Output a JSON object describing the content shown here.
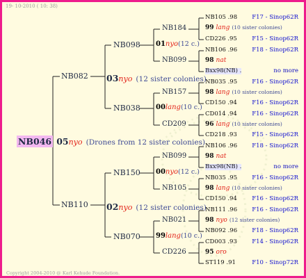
{
  "header": {
    "date": "19- 10-2010 ( 10: 38)"
  },
  "footer": {
    "copyright": "Copyright 2004-2010 @ Karl Kehude Foundation."
  },
  "focal": {
    "id": "NB046",
    "year": "05",
    "race": "nyo",
    "desc": "(Drones from 12 sister colonies)"
  },
  "gen1": [
    {
      "id": "NB082",
      "year": "03",
      "race": "nyo",
      "desc": "(12 sister colonies)"
    },
    {
      "id": "NB110",
      "year": "02",
      "race": "nyo",
      "desc": "(12 sister colonies)"
    }
  ],
  "gen2": [
    {
      "id": "NB098",
      "year": "01",
      "race": "nyo",
      "desc": "(12 c.)"
    },
    {
      "id": "NB038",
      "year": "00",
      "race": "lang",
      "desc": "(10 c.)"
    },
    {
      "id": "NB150",
      "year": "00",
      "race": "nyo",
      "desc": "(12 c.)"
    },
    {
      "id": "NB070",
      "year": "99",
      "race": "lang",
      "desc": "(10 c.)"
    }
  ],
  "gen3": [
    "NB184",
    "NB099",
    "NB157",
    "CD209",
    "NB099",
    "NB105",
    "NB021",
    "CD226"
  ],
  "gen4": [
    {
      "left": "NB105 .98",
      "right": "F17 - Sinop62R"
    },
    {
      "year": "99",
      "race": "lang",
      "desc": "(10 sister colonies)"
    },
    {
      "left": "CD226 .95",
      "right": "F15 - Sinop62R"
    },
    {
      "left": "NB106 .96",
      "right": "F18 - Sinop62R"
    },
    {
      "year": "98",
      "race": "nat",
      "desc": ""
    },
    {
      "left": "Bxx98(NB) .",
      "right": "no more",
      "hl": true
    },
    {
      "left": "NB035 .95",
      "right": "F16 - Sinop62R"
    },
    {
      "year": "98",
      "race": "lang",
      "desc": "(10 sister colonies)"
    },
    {
      "left": "CD150 .94",
      "right": "F16 - Sinop62R"
    },
    {
      "left": "CD014 .94",
      "right": "F16 - Sinop62R"
    },
    {
      "year": "96",
      "race": "lang",
      "desc": "(10 sister colonies)"
    },
    {
      "left": "CD218 .93",
      "right": "F15 - Sinop62R"
    },
    {
      "left": "NB106 .96",
      "right": "F18 - Sinop62R"
    },
    {
      "year": "98",
      "race": "nat",
      "desc": ""
    },
    {
      "left": "Bxx98(NB) .",
      "right": "no more",
      "hl": true
    },
    {
      "left": "NB035 .95",
      "right": "F16 - Sinop62R"
    },
    {
      "year": "98",
      "race": "lang",
      "desc": "(10 sister colonies)"
    },
    {
      "left": "CD150 .94",
      "right": "F16 - Sinop62R"
    },
    {
      "left": "NB111 .96",
      "right": "F16 - Sinop62R"
    },
    {
      "year": "98",
      "race": "nyo",
      "desc": "(12 sister colonies)"
    },
    {
      "left": "NB092 .96",
      "right": "F18 - Sinop62R"
    },
    {
      "left": "CD003 .93",
      "right": "F14 - Sinop62R"
    },
    {
      "year": "95",
      "race": "oro",
      "desc": ""
    },
    {
      "left": "ST119 .91",
      "right": "F10 - Sinop72R"
    }
  ]
}
